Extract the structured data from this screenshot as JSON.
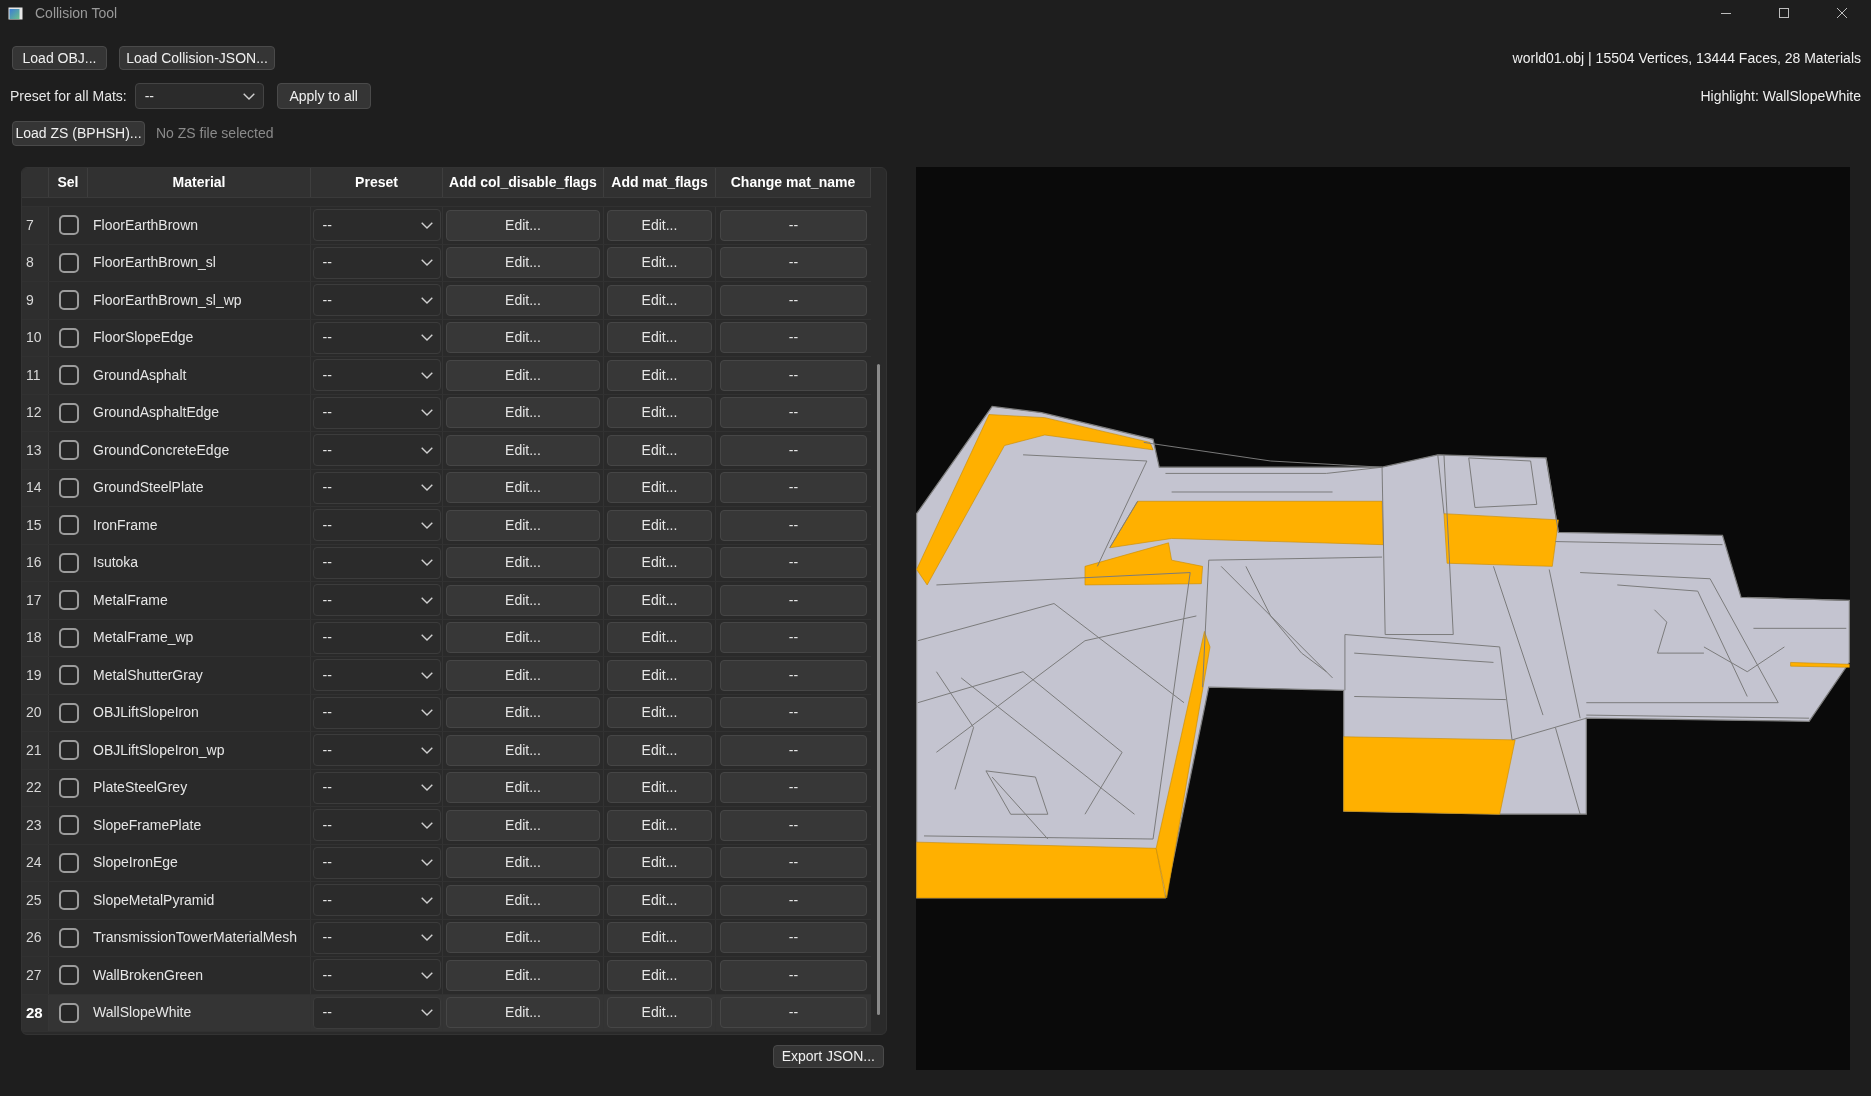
{
  "window": {
    "title": "Collision Tool"
  },
  "toolbar": {
    "buttons": [
      "Load OBJ...",
      "Load Collision-JSON..."
    ]
  },
  "model_info": "world01.obj | 15504 Vertices, 13444 Faces, 28 Materials",
  "preset_all": {
    "label": "Preset for all Mats:",
    "value": "--",
    "apply_button": "Apply to all"
  },
  "highlight": "Highlight: WallSlopeWhite",
  "zs": {
    "button": "Load ZS (BPHSH)...",
    "status": "No ZS file selected"
  },
  "table": {
    "columns": [
      "Sel",
      "Material",
      "Preset",
      "Add col_disable_flags",
      "Add mat_flags",
      "Change mat_name"
    ],
    "rows": [
      {
        "number": "7",
        "checked": false,
        "material": "FloorEarthBrown",
        "preset": "--",
        "col_disable_flags": "Edit...",
        "mat_flags": "Edit...",
        "mat_name": "--",
        "selected": false
      },
      {
        "number": "8",
        "checked": false,
        "material": "FloorEarthBrown_sl",
        "preset": "--",
        "col_disable_flags": "Edit...",
        "mat_flags": "Edit...",
        "mat_name": "--",
        "selected": false
      },
      {
        "number": "9",
        "checked": false,
        "material": "FloorEarthBrown_sl_wp",
        "preset": "--",
        "col_disable_flags": "Edit...",
        "mat_flags": "Edit...",
        "mat_name": "--",
        "selected": false
      },
      {
        "number": "10",
        "checked": false,
        "material": "FloorSlopeEdge",
        "preset": "--",
        "col_disable_flags": "Edit...",
        "mat_flags": "Edit...",
        "mat_name": "--",
        "selected": false
      },
      {
        "number": "11",
        "checked": false,
        "material": "GroundAsphalt",
        "preset": "--",
        "col_disable_flags": "Edit...",
        "mat_flags": "Edit...",
        "mat_name": "--",
        "selected": false
      },
      {
        "number": "12",
        "checked": false,
        "material": "GroundAsphaltEdge",
        "preset": "--",
        "col_disable_flags": "Edit...",
        "mat_flags": "Edit...",
        "mat_name": "--",
        "selected": false
      },
      {
        "number": "13",
        "checked": false,
        "material": "GroundConcreteEdge",
        "preset": "--",
        "col_disable_flags": "Edit...",
        "mat_flags": "Edit...",
        "mat_name": "--",
        "selected": false
      },
      {
        "number": "14",
        "checked": false,
        "material": "GroundSteelPlate",
        "preset": "--",
        "col_disable_flags": "Edit...",
        "mat_flags": "Edit...",
        "mat_name": "--",
        "selected": false
      },
      {
        "number": "15",
        "checked": false,
        "material": "IronFrame",
        "preset": "--",
        "col_disable_flags": "Edit...",
        "mat_flags": "Edit...",
        "mat_name": "--",
        "selected": false
      },
      {
        "number": "16",
        "checked": false,
        "material": "Isutoka",
        "preset": "--",
        "col_disable_flags": "Edit...",
        "mat_flags": "Edit...",
        "mat_name": "--",
        "selected": false
      },
      {
        "number": "17",
        "checked": false,
        "material": "MetalFrame",
        "preset": "--",
        "col_disable_flags": "Edit...",
        "mat_flags": "Edit...",
        "mat_name": "--",
        "selected": false
      },
      {
        "number": "18",
        "checked": false,
        "material": "MetalFrame_wp",
        "preset": "--",
        "col_disable_flags": "Edit...",
        "mat_flags": "Edit...",
        "mat_name": "--",
        "selected": false
      },
      {
        "number": "19",
        "checked": false,
        "material": "MetalShutterGray",
        "preset": "--",
        "col_disable_flags": "Edit...",
        "mat_flags": "Edit...",
        "mat_name": "--",
        "selected": false
      },
      {
        "number": "20",
        "checked": false,
        "material": "OBJLiftSlopeIron",
        "preset": "--",
        "col_disable_flags": "Edit...",
        "mat_flags": "Edit...",
        "mat_name": "--",
        "selected": false
      },
      {
        "number": "21",
        "checked": false,
        "material": "OBJLiftSlopeIron_wp",
        "preset": "--",
        "col_disable_flags": "Edit...",
        "mat_flags": "Edit...",
        "mat_name": "--",
        "selected": false
      },
      {
        "number": "22",
        "checked": false,
        "material": "PlateSteelGrey",
        "preset": "--",
        "col_disable_flags": "Edit...",
        "mat_flags": "Edit...",
        "mat_name": "--",
        "selected": false
      },
      {
        "number": "23",
        "checked": false,
        "material": "SlopeFramePlate",
        "preset": "--",
        "col_disable_flags": "Edit...",
        "mat_flags": "Edit...",
        "mat_name": "--",
        "selected": false
      },
      {
        "number": "24",
        "checked": false,
        "material": "SlopeIronEge",
        "preset": "--",
        "col_disable_flags": "Edit...",
        "mat_flags": "Edit...",
        "mat_name": "--",
        "selected": false
      },
      {
        "number": "25",
        "checked": false,
        "material": "SlopeMetalPyramid",
        "preset": "--",
        "col_disable_flags": "Edit...",
        "mat_flags": "Edit...",
        "mat_name": "--",
        "selected": false
      },
      {
        "number": "26",
        "checked": false,
        "material": "TransmissionTowerMaterialMesh",
        "preset": "--",
        "col_disable_flags": "Edit...",
        "mat_flags": "Edit...",
        "mat_name": "--",
        "selected": false
      },
      {
        "number": "27",
        "checked": false,
        "material": "WallBrokenGreen",
        "preset": "--",
        "col_disable_flags": "Edit...",
        "mat_flags": "Edit...",
        "mat_name": "--",
        "selected": false
      },
      {
        "number": "28",
        "checked": false,
        "material": "WallSlopeWhite",
        "preset": "--",
        "col_disable_flags": "Edit...",
        "mat_flags": "Edit...",
        "mat_name": "--",
        "selected": true
      }
    ]
  },
  "export_button": "Export JSON..."
}
